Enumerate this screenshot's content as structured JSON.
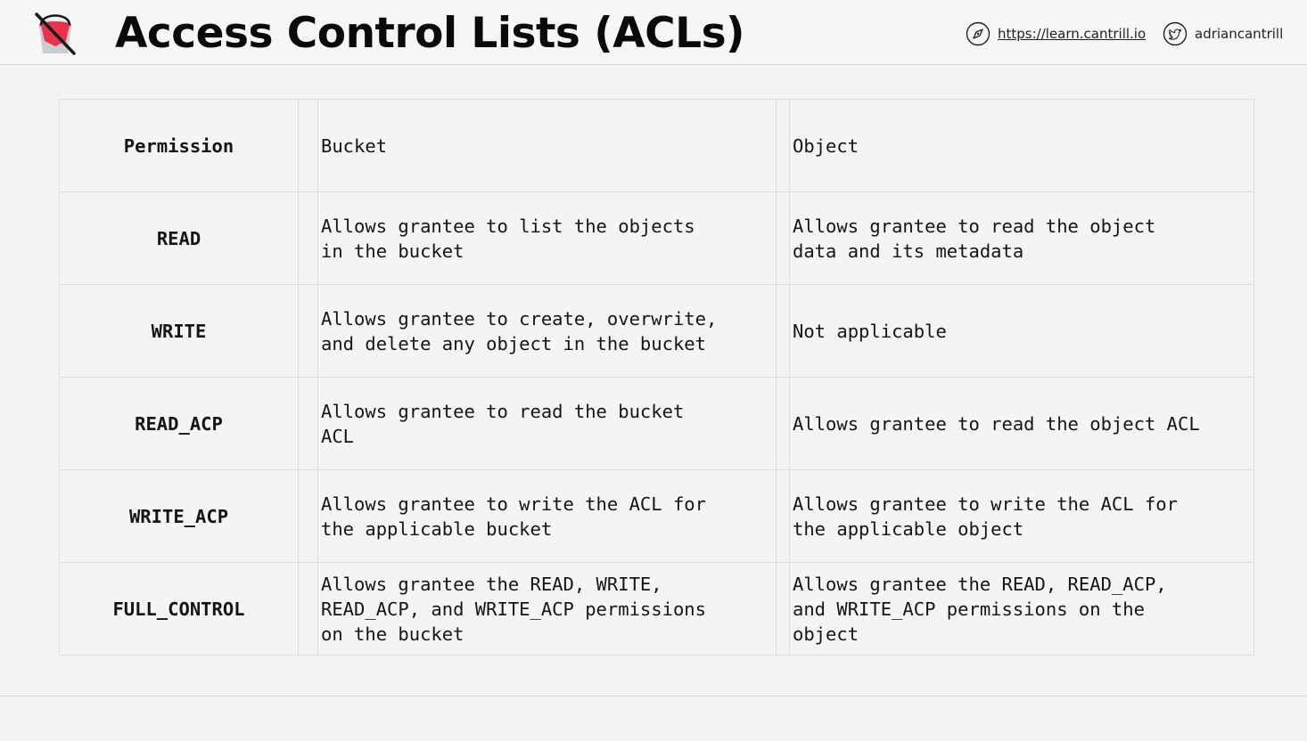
{
  "header": {
    "title": "Access Control Lists (ACLs)",
    "website_url": "https://learn.cantrill.io",
    "twitter_handle": "adriancantrill",
    "logo_icon": "bucket-logo-icon",
    "website_icon": "compass-icon",
    "twitter_icon": "twitter-bird-icon"
  },
  "table": {
    "headers": {
      "permission": "Permission",
      "bucket": "Bucket",
      "object": "Object"
    },
    "rows": [
      {
        "permission": "READ",
        "bucket": "Allows grantee to list the objects\nin the bucket",
        "object": "Allows grantee to read the object\ndata and its metadata"
      },
      {
        "permission": "WRITE",
        "bucket": "Allows grantee to create, overwrite,\nand delete any object in the bucket",
        "object": "Not applicable"
      },
      {
        "permission": "READ_ACP",
        "bucket": "Allows grantee to read the bucket\nACL",
        "object": "Allows grantee to read the object ACL"
      },
      {
        "permission": "WRITE_ACP",
        "bucket": "Allows grantee to write the ACL for\nthe applicable bucket",
        "object": "Allows grantee to write the ACL for\nthe applicable object"
      },
      {
        "permission": "FULL_CONTROL",
        "bucket": "Allows grantee the READ, WRITE,\nREAD_ACP, and WRITE_ACP permissions\non the bucket",
        "object": "Allows grantee the READ, READ_ACP,\nand WRITE_ACP permissions on the\nobject"
      }
    ]
  },
  "colors": {
    "background": "#f3f3f3",
    "logo_red": "#e8334a",
    "logo_grey": "#c9cdd2",
    "text": "#111111"
  }
}
